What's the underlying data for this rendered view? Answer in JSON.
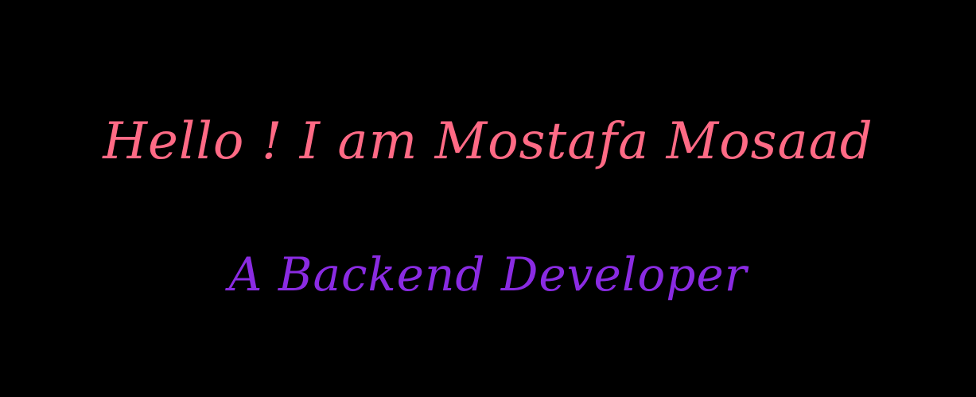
{
  "greeting": {
    "text": "Hello ! I am Mostafa Mosaad",
    "color": "#ff6a85"
  },
  "role": {
    "text": "A Backend Developer",
    "color": "#8a2be2"
  },
  "background_color": "#000000"
}
